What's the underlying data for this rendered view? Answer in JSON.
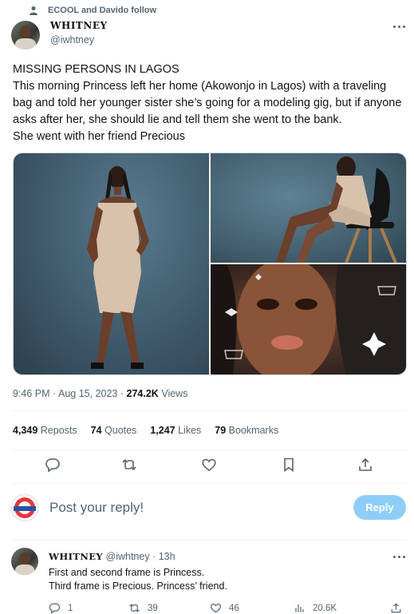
{
  "social_context": {
    "text": "ECOOL and Davido follow"
  },
  "author": {
    "name": "WHITNEY",
    "handle": "@iwhtney"
  },
  "tweet": {
    "lines": [
      "MISSING PERSONS IN LAGOS",
      "This morning Princess left her home (Akowonjo in Lagos) with a traveling bag and told her younger sister she’s going for a modeling gig, but if anyone asks after her, she should lie and tell them she went to the bank.",
      "She went with her friend Precious"
    ]
  },
  "meta": {
    "time": "9:46 PM",
    "sep": "·",
    "date": "Aug 15, 2023",
    "sep2": "·",
    "views_count": "274.2K",
    "views_label": "Views"
  },
  "stats": [
    {
      "count": "4,349",
      "label": "Reposts"
    },
    {
      "count": "74",
      "label": "Quotes"
    },
    {
      "count": "1,247",
      "label": "Likes"
    },
    {
      "count": "79",
      "label": "Bookmarks"
    }
  ],
  "composer": {
    "placeholder": "Post your reply!",
    "button": "Reply"
  },
  "reply": {
    "name": "WHITNEY",
    "handle": "@iwhtney",
    "sep": "·",
    "time": "13h",
    "lines": [
      "First and second frame is Princess.",
      "Third frame is Precious. Princess’ friend."
    ],
    "replies": "1",
    "reposts": "39",
    "likes": "46",
    "views": "20.6K"
  },
  "colors": {
    "accent": "#1d9bf0",
    "muted": "#536471",
    "reply_button": "#8ecdf8"
  }
}
